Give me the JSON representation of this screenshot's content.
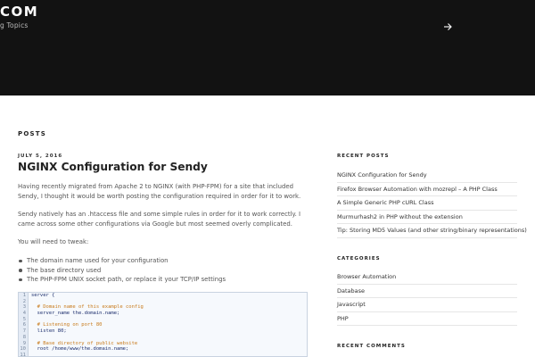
{
  "header": {
    "site_title": "COM",
    "site_description": "g Topics",
    "menu_icon": "arrow-right-icon"
  },
  "posts_heading": "POSTS",
  "post": {
    "date": "JULY 5, 2016",
    "title": "NGINX Configuration for Sendy",
    "paragraphs": [
      "Having recently migrated from Apache 2 to NGINX (with PHP-FPM) for a site that included Sendy, I thought it would be worth posting the configuration required in order for it to work.",
      "Sendy natively has an .htaccess file and some simple rules in order for it to work correctly. I came across some other configurations via Google but most seemed overly complicated.",
      "You will need to tweak:"
    ],
    "bullets": [
      "The domain name used for your configuration",
      "The base directory used",
      "The PHP-FPM UNIX socket path, or replace it your TCP/IP settings"
    ],
    "code_lines": [
      {
        "n": "1",
        "text": "server {",
        "comment": false
      },
      {
        "n": "2",
        "text": "",
        "comment": false
      },
      {
        "n": "3",
        "text": "  # Domain name of this example config",
        "comment": true
      },
      {
        "n": "4",
        "text": "  server_name the.domain.name;",
        "comment": false
      },
      {
        "n": "5",
        "text": "",
        "comment": false
      },
      {
        "n": "6",
        "text": "  # Listening on port 80",
        "comment": true
      },
      {
        "n": "7",
        "text": "  listen 80;",
        "comment": false
      },
      {
        "n": "8",
        "text": "",
        "comment": false
      },
      {
        "n": "9",
        "text": "  # Base directory of public website",
        "comment": true
      },
      {
        "n": "10",
        "text": "  root /home/www/the.domain.name;",
        "comment": false
      },
      {
        "n": "11",
        "text": "",
        "comment": false
      }
    ]
  },
  "sidebar": {
    "recent_posts_title": "RECENT POSTS",
    "recent_posts": [
      "NGINX Configuration for Sendy",
      "Firefox Browser Automation with mozrepl – A PHP Class",
      "A Simple Generic PHP cURL Class",
      "Murmurhash2 in PHP without the extension",
      "Tip: Storing MD5 Values (and other string/binary representations)"
    ],
    "categories_title": "CATEGORIES",
    "categories": [
      "Browser Automation",
      "Database",
      "Javascript",
      "PHP"
    ],
    "recent_comments_title": "RECENT COMMENTS"
  }
}
